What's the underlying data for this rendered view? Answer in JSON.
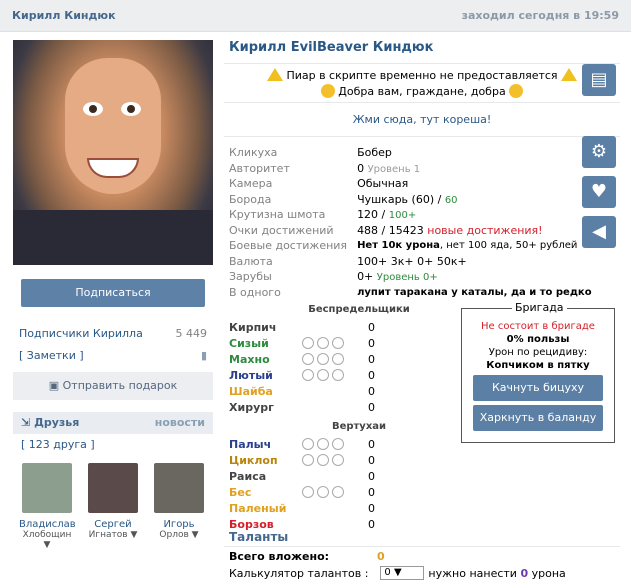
{
  "top": {
    "name": "Кирилл Киндюк",
    "seen": "заходил сегодня в 19:59"
  },
  "left": {
    "subscribe": "Подписаться",
    "subscribers_label": "Подписчики Кирилла",
    "subscribers_count": "5 449",
    "notes": "[ Заметки ]",
    "gift": "Отправить подарок",
    "friends_title": "Друзья",
    "friends_new": "новости",
    "friends_count": "[ 123 друга ]",
    "friends": [
      {
        "first": "Владислав",
        "last": "Хлобощин"
      },
      {
        "first": "Сергей",
        "last": "Игнатов"
      },
      {
        "first": "Игорь",
        "last": "Орлов"
      }
    ]
  },
  "right": {
    "name": "Кирилл EvilBeaver Киндюк",
    "promo1": "Пиар в скрипте временно не предоставляется",
    "promo2": "Добра вам, граждане, добра",
    "link": "Жми сюда, тут кореша!",
    "info": [
      {
        "k": "Кликуха",
        "v": "Бобер"
      },
      {
        "k": "Авторитет",
        "v": "0",
        "extra": "Уровень 1"
      },
      {
        "k": "Камера",
        "v": "Обычная"
      },
      {
        "k": "Борода",
        "v": "Чушкарь (60) /",
        "extra": "60"
      },
      {
        "k": "Крутизна шмота",
        "v": "120 /",
        "extra": "100+"
      },
      {
        "k": "Очки достижений",
        "v": "488 / 15423",
        "extra": "новые достижения!"
      },
      {
        "k": "Боевые достижения",
        "v": "Нет 10к урона",
        "extra": ", нет 100 яда, 50+ рублей"
      },
      {
        "k": "Валюта",
        "v": "100+ 3к+ 0+ 50к+"
      },
      {
        "k": "Зарубы",
        "v": "0+",
        "extra": "Уровень 0+"
      },
      {
        "k": "В одного",
        "v": "лупит таракана у каталы, да и то редко"
      }
    ],
    "sect1": "Беспредельщики",
    "stats1": [
      {
        "n": "Кирпич",
        "v": "0",
        "color": "#444444"
      },
      {
        "n": "Сизый",
        "v": "0",
        "color": "#2e8b3e"
      },
      {
        "n": "Махно",
        "v": "0",
        "color": "#2e8b3e"
      },
      {
        "n": "Лютый",
        "v": "0",
        "color": "#2a3f8f"
      },
      {
        "n": "Шайба",
        "v": "0",
        "color": "#e0a020"
      },
      {
        "n": "Хирург",
        "v": "0",
        "color": "#444444"
      }
    ],
    "sect2": "Вертухаи",
    "stats2": [
      {
        "n": "Палыч",
        "v": "0",
        "color": "#2a3f8f"
      },
      {
        "n": "Циклоп",
        "v": "0",
        "color": "#b8860b"
      },
      {
        "n": "Раиса",
        "v": "0",
        "color": "#444444"
      },
      {
        "n": "Бес",
        "v": "0",
        "color": "#e0a020"
      },
      {
        "n": "Паленый",
        "v": "0",
        "color": "#e0a020"
      },
      {
        "n": "Борзов",
        "v": "0",
        "color": "#d3202a"
      }
    ],
    "brigade": {
      "title": "Бригада",
      "status": "Не состоит в бригаде",
      "use": "0% пользы",
      "dmg_label": "Урон по рецидиву:",
      "dmg": "Копчиком в пятку",
      "btn1": "Качнуть бицуху",
      "btn2": "Харкнуть в баланду"
    },
    "talents": {
      "title": "Таланты",
      "invested_label": "Всего вложено:",
      "invested": "0",
      "calc_label": "Калькулятор талантов :",
      "calc_value": "0",
      "need": "нужно нанести",
      "need_val": "0",
      "need_unit": "урона"
    }
  }
}
